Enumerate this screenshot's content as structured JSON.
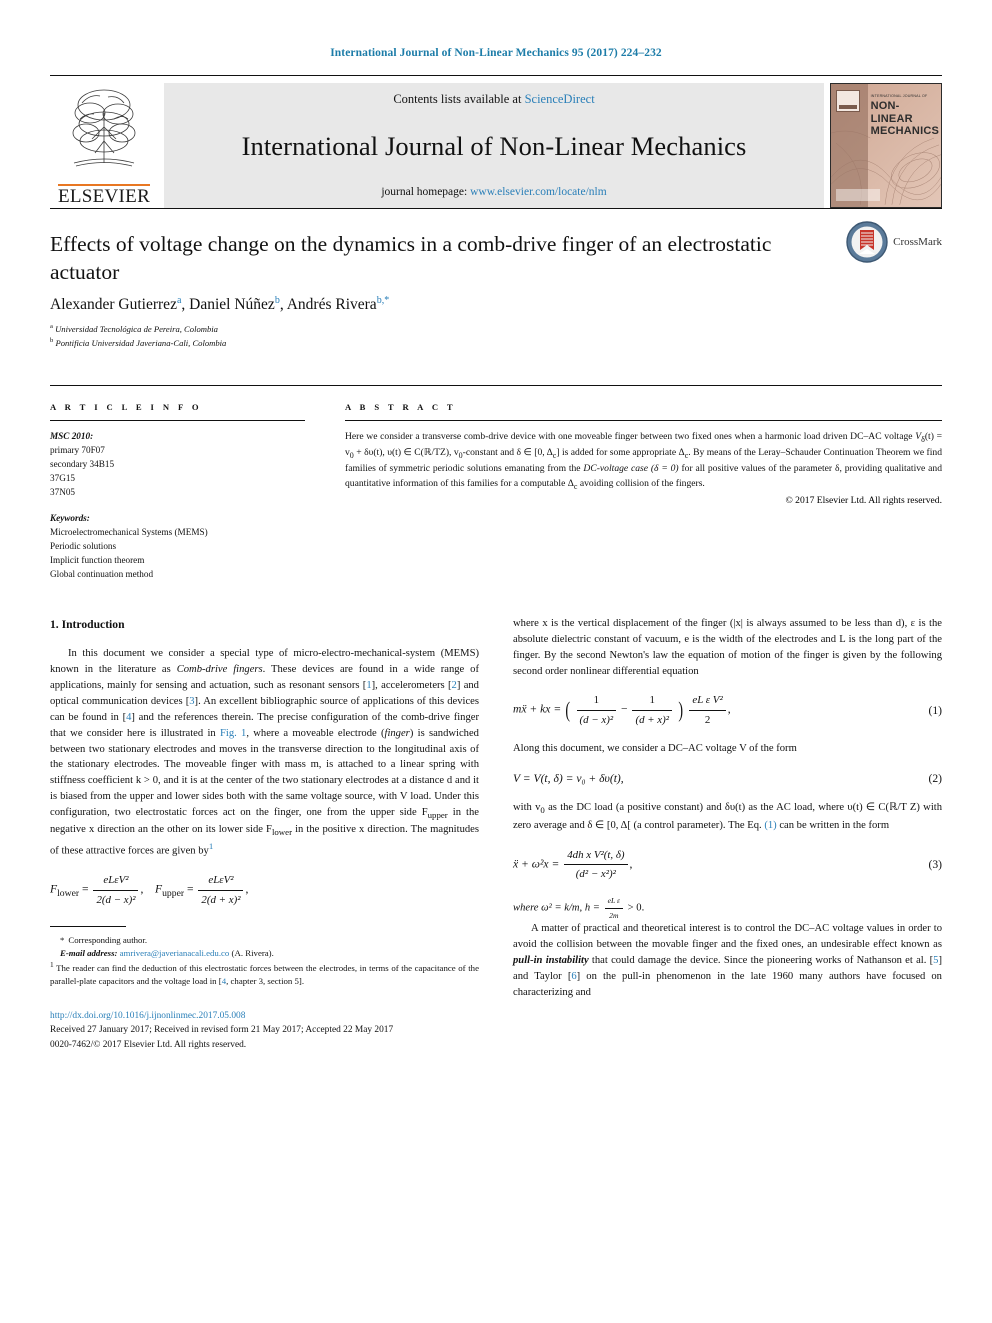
{
  "running_head": "International Journal of Non-Linear Mechanics 95 (2017) 224–232",
  "masthead": {
    "contents_prefix": "Contents lists available at ",
    "sciencedirect": "ScienceDirect",
    "journal_name": "International Journal of Non-Linear Mechanics",
    "homepage_prefix": "journal homepage: ",
    "homepage_url": "www.elsevier.com/locate/nlm",
    "publisher": "ELSEVIER",
    "cover": {
      "sup_line": "INTERNATIONAL JOURNAL OF",
      "line1": "NON-LINEAR",
      "line2": "MECHANICS"
    },
    "colors": {
      "link": "#2a7fb8",
      "band": "#e8e8e8",
      "elsevier_orange": "#e87722"
    }
  },
  "article": {
    "title": "Effects of voltage change on the dynamics in a comb-drive finger of an electrostatic actuator",
    "authors": [
      {
        "name": "Alexander Gutierrez",
        "sup": "a"
      },
      {
        "name": "Daniel Núñez",
        "sup": "b"
      },
      {
        "name": "Andrés Rivera",
        "sup": "b,"
      }
    ],
    "authors_line": "Alexander Gutierrez, Daniel Núñez, Andrés Rivera",
    "affiliations": [
      {
        "mark": "a",
        "text": "Universidad Tecnológica de Pereira, Colombia"
      },
      {
        "mark": "b",
        "text": "Pontificia Universidad Javeriana-Cali, Colombia"
      }
    ],
    "crossmark_label": "CrossMark"
  },
  "article_info": {
    "heading": "A R T I C L E    I N F O",
    "msc_head": "MSC 2010:",
    "msc_items": [
      "primary 70F07",
      "secondary 34B15",
      "37G15",
      "37N05"
    ],
    "keywords_head": "Keywords:",
    "keywords": [
      "Microelectromechanical Systems (MEMS)",
      "Periodic solutions",
      "Implicit function theorem",
      "Global continuation method"
    ]
  },
  "abstract": {
    "heading": "A B S T R A C T",
    "text_1": "Here we consider a transverse comb-drive device with one moveable finger between two fixed ones when a harmonic load driven DC–AC voltage ",
    "math_1": "V",
    "math_1_sub": "δ",
    "text_2": "(t) = v",
    "text_2b": "0",
    "text_3": " + δυ(t), υ(t) ∈ C(ℝ/TZ), v",
    "text_3b": "0",
    "text_4": "-constant and δ ∈ [0, Δ",
    "text_4b": "c",
    "text_5": "] is added for some appropriate Δ",
    "text_5b": "c",
    "text_6": ". By means of the Leray–Schauder Continuation Theorem we find families of symmetric periodic solutions emanating from the ",
    "text_7": "DC-voltage case (δ = 0)",
    "text_8": " for all positive values of the parameter δ, providing qualitative and quantitative information of this families for a computable Δ",
    "text_8b": "c",
    "text_9": " avoiding collision of the fingers.",
    "copyright": "© 2017 Elsevier Ltd. All rights reserved."
  },
  "left_column": {
    "section_heading": "1. Introduction",
    "p1_a": "In this document we consider a special type of  micro-electro-mechanical-system (MEMS) known in the literature as  ",
    "p1_it": "Comb-drive fingers",
    "p1_b": ". These devices are found in a wide range of applications, mainly for sensing and actuation, such as resonant sensors [",
    "ref1": "1",
    "p1_c": "], accelerometers [",
    "ref2": "2",
    "p1_d": "] and optical communication devices [",
    "ref3": "3",
    "p1_e": "]. An excellent bibliographic source of applications of this devices can be found in [",
    "ref4": "4",
    "p1_f": "] and the references therein. The precise configuration of the comb-drive finger that we consider here is illustrated in ",
    "fig1": "Fig. 1",
    "p1_g": ", where a moveable electrode (",
    "p1_it2": "finger",
    "p1_h": ") is sandwiched between two stationary electrodes and moves in the transverse direction to the longitudinal axis of the stationary electrodes. The moveable finger with mass m, is attached to a linear spring with stiffness coefficient k > 0, and it is at the center of the two stationary electrodes at a distance d and it is biased from the upper and lower sides both with the same voltage source, with V load. Under this configuration, two electrostatic forces act on the finger, one from the upper side F",
    "p1_sub1": "upper",
    "p1_i": " in the negative x direction an the other on its lower side F",
    "p1_sub2": "lower",
    "p1_j": " in the positive x direction. The magnitudes of these attractive forces are given by",
    "footnote_marker": "1",
    "equation_forces": {
      "lower_label": "F",
      "lower_sub": "lower",
      "upper_label": "F",
      "upper_sub": "upper",
      "num": "eLεV²",
      "den_lower": "2(d − x)²",
      "den_upper": "2(d + x)²"
    }
  },
  "footnotes": {
    "corresponding": "Corresponding author.",
    "email_label": "E-mail address:",
    "email": "amrivera@javerianacali.edu.co",
    "email_author": "(A. Rivera).",
    "fn1_marker": "1",
    "fn1_text_a": "The reader can find the deduction of this electrostatic forces between the electrodes, in terms of the capacitance of the parallel-plate capacitors and the voltage load in [",
    "fn1_ref": "4",
    "fn1_text_b": ", chapter 3, section 5]."
  },
  "doi_block": {
    "doi": "http://dx.doi.org/10.1016/j.ijnonlinmec.2017.05.008",
    "dates": "Received 27 January 2017; Received in revised form 21 May 2017; Accepted 22 May 2017",
    "issn": "0020-7462/© 2017 Elsevier Ltd. All rights reserved."
  },
  "right_column": {
    "p1": "where x is the vertical displacement of the finger (|x| is always assumed to be less than d), ε is the absolute dielectric constant of vacuum, e is the width of the electrodes and L is the long part of the finger. By the second Newton's law the equation of motion of the finger is given by the following second order nonlinear differential equation",
    "eq1": {
      "lhs": "mẍ + kx =",
      "num1": "1",
      "den1": "(d − x)²",
      "num2": "1",
      "den2": "(d + x)²",
      "tail_num": "eL ε V²",
      "tail_den": "2",
      "number": "(1)"
    },
    "p2": "Along this document, we consider a DC–AC voltage V of the form",
    "eq2": {
      "body": "V = V(t, δ) = v₀ + δυ(t),",
      "number": "(2)"
    },
    "p3_a": "with v",
    "p3_sub": "0",
    "p3_b": " as the DC load (a positive constant) and δυ(t) as the AC load, where υ(t) ∈ C(ℝ/T Z) with zero average and δ ∈ [0, Δ[ (a control parameter). The Eq. ",
    "p3_ref": "(1)",
    "p3_c": " can be written in the form",
    "eq3": {
      "lhs": "ẍ + ω²x =",
      "num": "4dh x V²(t, δ)",
      "den": "(d² − x²)²",
      "number": "(3)"
    },
    "p4_a": "where ω² = k/m, h = ",
    "p4_frac_num": "eL ε",
    "p4_frac_den": "2m",
    "p4_b": " > 0.",
    "p5_a": "A matter of practical and theoretical interest is to control the DC–AC voltage values in order to avoid the collision between the movable finger and the fixed ones, an undesirable effect known as ",
    "p5_it": "pull-in instability",
    "p5_b": " that could damage the device. Since the pioneering works of Nathanson et al. [",
    "p5_ref1": "5",
    "p5_c": "] and Taylor [",
    "p5_ref2": "6",
    "p5_d": "] on the pull-in phenomenon in the late 1960 many authors have focused on characterizing and"
  }
}
